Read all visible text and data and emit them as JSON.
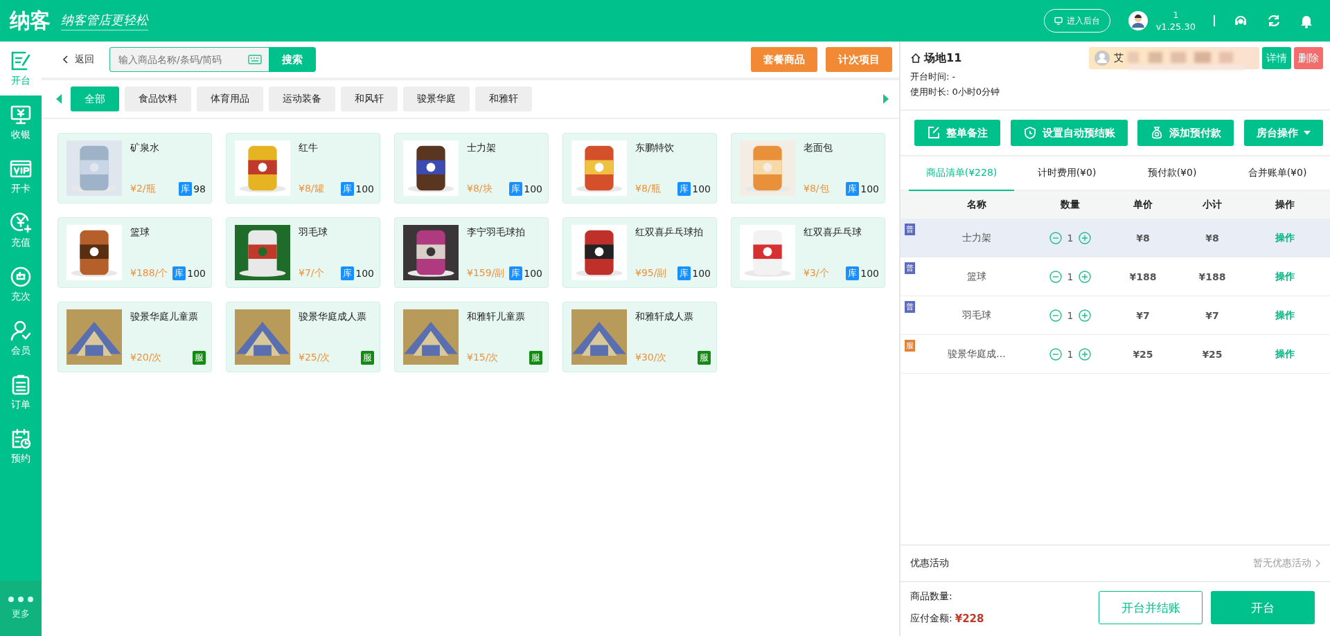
{
  "header": {
    "logo": "纳客",
    "slogan": "纳客管店更轻松",
    "backend_button": "进入后台",
    "user": "1",
    "version": "v1.25.30"
  },
  "sidebar": {
    "items": [
      {
        "label": "开台",
        "selected": true
      },
      {
        "label": "收银",
        "selected": false
      },
      {
        "label": "开卡",
        "selected": false
      },
      {
        "label": "充值",
        "selected": false
      },
      {
        "label": "充次",
        "selected": false
      },
      {
        "label": "会员",
        "selected": false
      },
      {
        "label": "订单",
        "selected": false
      },
      {
        "label": "预约",
        "selected": false
      }
    ],
    "more": "更多"
  },
  "toolbar": {
    "back": "返回",
    "search": {
      "placeholder": "输入商品名称/条码/简码"
    },
    "search_button": "搜索",
    "buttons": [
      "套餐商品",
      "计次项目"
    ]
  },
  "categories": [
    {
      "label": "全部",
      "selected": true
    },
    {
      "label": "食品饮料",
      "selected": false
    },
    {
      "label": "体育用品",
      "selected": false
    },
    {
      "label": "运动装备",
      "selected": false
    },
    {
      "label": "和风轩",
      "selected": false
    },
    {
      "label": "骏景华庭",
      "selected": false
    },
    {
      "label": "和雅轩",
      "selected": false
    }
  ],
  "products": [
    {
      "kind": "goods",
      "name": "矿泉水",
      "price": "¥2/瓶",
      "badge": "库",
      "stock": "98"
    },
    {
      "kind": "goods",
      "name": "红牛",
      "price": "¥8/罐",
      "badge": "库",
      "stock": "100"
    },
    {
      "kind": "goods",
      "name": "士力架",
      "price": "¥8/块",
      "badge": "库",
      "stock": "100"
    },
    {
      "kind": "goods",
      "name": "东鹏特饮",
      "price": "¥8/瓶",
      "badge": "库",
      "stock": "100"
    },
    {
      "kind": "goods",
      "name": "老面包",
      "price": "¥8/包",
      "badge": "库",
      "stock": "100"
    },
    {
      "kind": "goods",
      "name": "篮球",
      "price": "¥188/个",
      "badge": "库",
      "stock": "100"
    },
    {
      "kind": "goods",
      "name": "羽毛球",
      "price": "¥7/个",
      "badge": "库",
      "stock": "100"
    },
    {
      "kind": "goods",
      "name": "李宁羽毛球拍",
      "price": "¥159/副",
      "badge": "库",
      "stock": "100"
    },
    {
      "kind": "goods",
      "name": "红双喜乒乓球拍",
      "price": "¥95/副",
      "badge": "库",
      "stock": "100"
    },
    {
      "kind": "goods",
      "name": "红双喜乒乓球",
      "price": "¥3/个",
      "badge": "库",
      "stock": "100"
    },
    {
      "kind": "service",
      "name": "骏景华庭儿童票",
      "price": "¥20/次",
      "badge": "服"
    },
    {
      "kind": "service",
      "name": "骏景华庭成人票",
      "price": "¥25/次",
      "badge": "服"
    },
    {
      "kind": "service",
      "name": "和雅轩儿童票",
      "price": "¥15/次",
      "badge": "服"
    },
    {
      "kind": "service",
      "name": "和雅轩成人票",
      "price": "¥30/次",
      "badge": "服"
    }
  ],
  "room": {
    "title": "场地11",
    "member": "艾",
    "detail_button": "详情",
    "delete_button": "删除",
    "open_time": "开台时间: -",
    "duration": "使用时长: 0小时0分钟"
  },
  "actions": [
    {
      "label": "整单备注",
      "dropdown": false
    },
    {
      "label": "设置自动预结账",
      "dropdown": false
    },
    {
      "label": "添加预付款",
      "dropdown": false
    },
    {
      "label": "房台操作",
      "dropdown": true
    }
  ],
  "order_tabs": [
    {
      "label": "商品清单(¥228)",
      "selected": true
    },
    {
      "label": "计时费用(¥0)",
      "selected": false
    },
    {
      "label": "预付款(¥0)",
      "selected": false
    },
    {
      "label": "合并账单(¥0)",
      "selected": false
    }
  ],
  "order_table": {
    "columns": [
      "名称",
      "数量",
      "单价",
      "小计",
      "操作"
    ],
    "rows": [
      {
        "tag": "普",
        "color": "#5c6bc0",
        "name": "士力架",
        "qty": "1",
        "price": "¥8",
        "subtotal": "¥8",
        "action": "操作",
        "selected": true
      },
      {
        "tag": "普",
        "color": "#5c6bc0",
        "name": "篮球",
        "qty": "1",
        "price": "¥188",
        "subtotal": "¥188",
        "action": "操作",
        "selected": false
      },
      {
        "tag": "普",
        "color": "#5c6bc0",
        "name": "羽毛球",
        "qty": "1",
        "price": "¥7",
        "subtotal": "¥7",
        "action": "操作",
        "selected": false
      },
      {
        "tag": "服",
        "color": "#e0823a",
        "name": "骏景华庭成...",
        "qty": "1",
        "price": "¥25",
        "subtotal": "¥25",
        "action": "操作",
        "selected": false
      }
    ]
  },
  "promotion": {
    "label": "优惠活动",
    "value": "暂无优惠活动"
  },
  "summary": {
    "count_label": "商品数量:",
    "amount_label": "应付金额:",
    "amount": "¥228"
  },
  "footer_buttons": [
    {
      "label": "开台并结账",
      "kind": "outline"
    },
    {
      "label": "开台",
      "kind": "primary"
    }
  ]
}
